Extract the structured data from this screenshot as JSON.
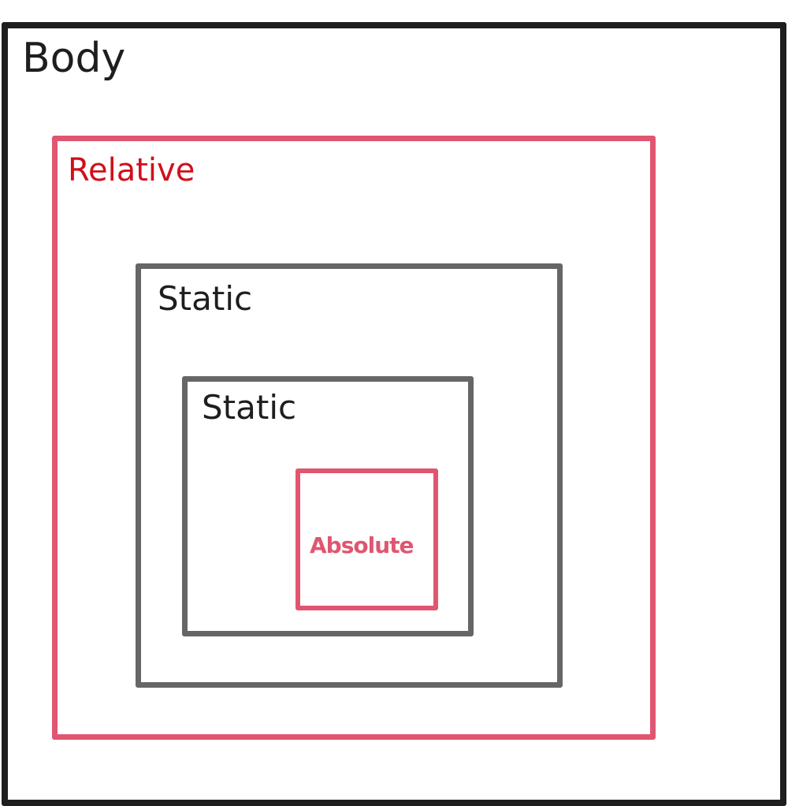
{
  "diagram": {
    "boxes": [
      {
        "id": "body",
        "label": "Body",
        "border_color": "#1e1e1e",
        "label_color": "#1e1e1e"
      },
      {
        "id": "relative",
        "label": "Relative",
        "border_color": "#e05670",
        "label_color": "#d0101c"
      },
      {
        "id": "static_outer",
        "label": "Static",
        "border_color": "#666666",
        "label_color": "#1e1e1e"
      },
      {
        "id": "static_inner",
        "label": "Static",
        "border_color": "#666666",
        "label_color": "#1e1e1e"
      },
      {
        "id": "absolute",
        "label": "Absolute",
        "border_color": "#e05670",
        "label_color": "#e05670"
      }
    ]
  }
}
